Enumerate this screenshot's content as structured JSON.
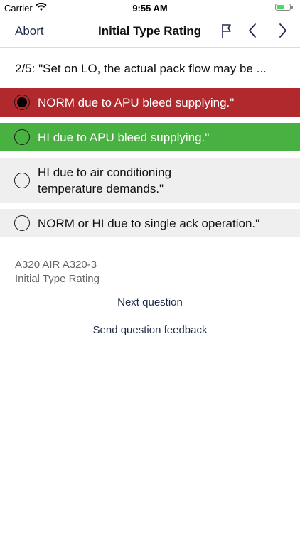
{
  "status_bar": {
    "carrier": "Carrier",
    "time": "9:55 AM",
    "battery_level": 0.55,
    "battery_color": "#4cd964"
  },
  "nav": {
    "abort_label": "Abort",
    "title": "Initial Type Rating",
    "icons": [
      "flag-icon",
      "chevron-left-icon",
      "chevron-right-icon"
    ]
  },
  "question": {
    "text": "2/5: \"Set on LO, the actual pack flow may be ..."
  },
  "answers": [
    {
      "lines": [
        "NORM due to APU bleed supplying.\""
      ],
      "selected": true,
      "state": "incorrect",
      "color": "#b1282d"
    },
    {
      "lines": [
        "HI due to APU bleed supplying.\""
      ],
      "selected": false,
      "state": "correct",
      "color": "#49b042"
    },
    {
      "lines": [
        "HI due to air conditioning",
        "temperature demands.\""
      ],
      "selected": false,
      "state": "neutral",
      "color": "#efefef"
    },
    {
      "lines": [
        "NORM or HI due to single ack operation.\""
      ],
      "selected": false,
      "state": "neutral",
      "color": "#efefef"
    }
  ],
  "meta": {
    "aircraft": "A320 AIR A320-3",
    "course": "Initial Type Rating"
  },
  "links": {
    "next": "Next question",
    "feedback": "Send question feedback"
  }
}
